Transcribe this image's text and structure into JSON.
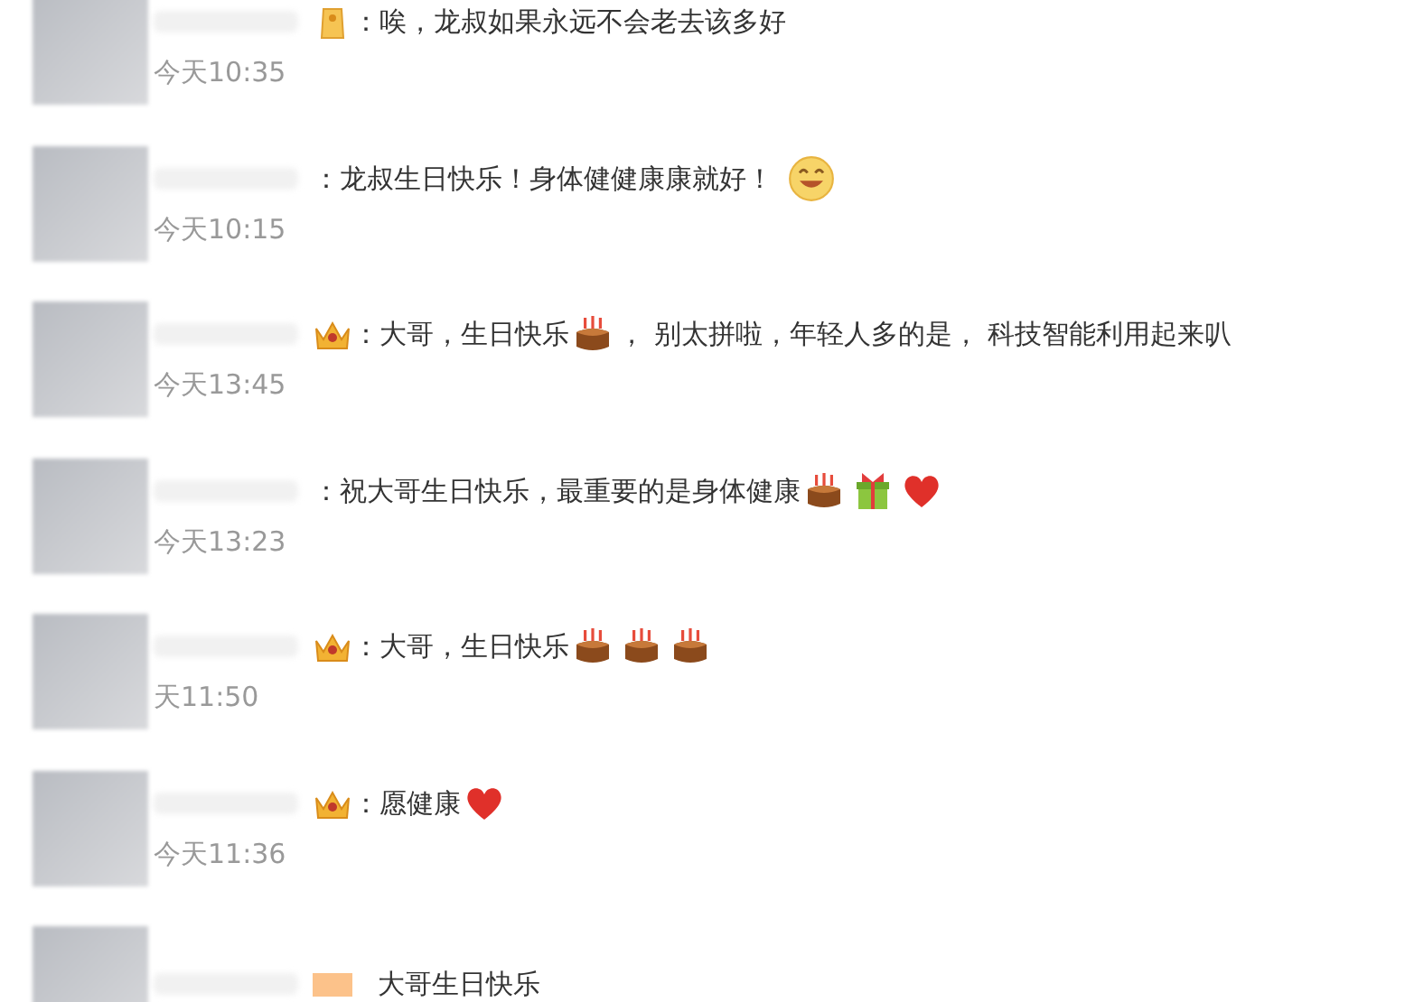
{
  "comments": [
    {
      "parts": [
        {
          "kind": "figure_badge"
        },
        {
          "kind": "text",
          "text": "：唉，龙叔如果永远不会老去该多好"
        }
      ],
      "time": "今天10:35"
    },
    {
      "parts": [
        {
          "kind": "text",
          "text": "：龙叔生日快乐！身体健健康康就好！"
        },
        {
          "kind": "smile"
        }
      ],
      "time": "今天10:15"
    },
    {
      "parts": [
        {
          "kind": "crown_badge"
        },
        {
          "kind": "text",
          "text": "：大哥，生日快乐"
        },
        {
          "kind": "cake"
        },
        {
          "kind": "text",
          "text": "， 别太拼啦，年轻人多的是， 科技智能利用起来叭"
        }
      ],
      "time": "今天13:45"
    },
    {
      "parts": [
        {
          "kind": "text",
          "text": "：祝大哥生日快乐，最重要的是身体健康"
        },
        {
          "kind": "cake"
        },
        {
          "kind": "gift"
        },
        {
          "kind": "heart"
        }
      ],
      "time": "今天13:23"
    },
    {
      "parts": [
        {
          "kind": "crown_badge"
        },
        {
          "kind": "text",
          "text": "：大哥，生日快乐"
        },
        {
          "kind": "cake"
        },
        {
          "kind": "cake"
        },
        {
          "kind": "cake"
        }
      ],
      "time": "天11:50"
    },
    {
      "parts": [
        {
          "kind": "crown_badge"
        },
        {
          "kind": "text",
          "text": "：愿健康"
        },
        {
          "kind": "heart"
        }
      ],
      "time": "今天11:36"
    },
    {
      "parts": [
        {
          "kind": "blurred_badge"
        },
        {
          "kind": "text",
          "text": "大哥生日快乐"
        }
      ]
    }
  ]
}
